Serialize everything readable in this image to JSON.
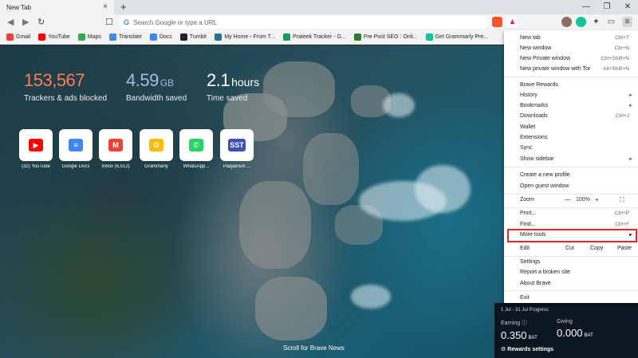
{
  "tabs": [
    {
      "label": "New Tab",
      "close": "×"
    }
  ],
  "newtab_symbol": "+",
  "window": {
    "minimize": "—",
    "maximize": "❐",
    "close": "✕"
  },
  "nav": {
    "back": "◀",
    "forward": "▶",
    "reload": "↻",
    "bookmark": "☐"
  },
  "omnibox": {
    "g": "G",
    "placeholder": "Search Google or type a URL"
  },
  "bookmarks": [
    {
      "label": "Gmail",
      "color": "#ea4335"
    },
    {
      "label": "YouTube",
      "color": "#ff0000"
    },
    {
      "label": "Maps",
      "color": "#34a853"
    },
    {
      "label": "Translate",
      "color": "#4285f4"
    },
    {
      "label": "Docs",
      "color": "#4285f4"
    },
    {
      "label": "Tumblr",
      "color": "#222"
    },
    {
      "label": "My Home ‹ From T...",
      "color": "#21759b"
    },
    {
      "label": "Prateek Tracker - G...",
      "color": "#0f9d58"
    },
    {
      "label": "Pre Post SEO : Onli...",
      "color": "#2e7d32"
    },
    {
      "label": "Get Grammarly Pre...",
      "color": "#15c39a"
    }
  ],
  "stats": [
    {
      "num": "153,567",
      "unit": "",
      "label": "Trackers & ads blocked",
      "color": "#ff7b54"
    },
    {
      "num": "4.59",
      "unit": "GB",
      "label": "Bandwidth saved",
      "color": "#a9b8dc"
    },
    {
      "num": "2.1",
      "unit": "hours",
      "label": "Time saved",
      "color": "#ffffff"
    }
  ],
  "sites": [
    {
      "name": "(32) YouTube",
      "glyph": "▶",
      "bg": "#ff0000"
    },
    {
      "name": "Google Docs",
      "glyph": "≡",
      "bg": "#4285f4"
    },
    {
      "name": "Inbox (6,512)",
      "glyph": "M",
      "bg": "#ea4335"
    },
    {
      "name": "Grammarly",
      "glyph": "G",
      "bg": "#fbbc05"
    },
    {
      "name": "WhatsApp...",
      "glyph": "✆",
      "bg": "#25d366"
    },
    {
      "name": "Plagiarism ...",
      "glyph": "SST",
      "bg": "#3f51b5"
    }
  ],
  "scroll_news": "Scroll for Brave News",
  "rewards": {
    "period": "1 Jul - 31 Jul Progress",
    "earning_label": "Earning ⓘ",
    "earning_value": "0.350",
    "giving_label": "Giving",
    "giving_value": "0.000",
    "currency": "BAT",
    "settings": "⚙ Rewards settings"
  },
  "menu": {
    "new_tab": {
      "label": "New tab",
      "shortcut": "Ctrl+T"
    },
    "new_window": {
      "label": "New window",
      "shortcut": "Ctrl+N"
    },
    "new_private": {
      "label": "New Private window",
      "shortcut": "Ctrl+Shift+N"
    },
    "new_private_tor": {
      "label": "New private window with Tor",
      "shortcut": "Alt+Shift+N"
    },
    "brave_rewards": "Brave Rewards",
    "history": "History",
    "bookmarks": "Bookmarks",
    "downloads": {
      "label": "Downloads",
      "shortcut": "Ctrl+J"
    },
    "wallet": "Wallet",
    "extensions": "Extensions",
    "sync": "Sync",
    "show_sidebar": "Show sidebar",
    "create_profile": "Create a new profile",
    "guest": "Open guest window",
    "zoom": {
      "label": "Zoom",
      "minus": "—",
      "value": "100%",
      "plus": "+",
      "fullscreen": "⛶"
    },
    "print": {
      "label": "Print...",
      "shortcut": "Ctrl+P"
    },
    "find": {
      "label": "Find...",
      "shortcut": "Ctrl+F"
    },
    "more_tools": "More tools",
    "edit": {
      "label": "Edit",
      "cut": "Cut",
      "copy": "Copy",
      "paste": "Paste"
    },
    "settings": "Settings",
    "report": "Report a broken site",
    "about": "About Brave",
    "exit": "Exit",
    "arrow": "►"
  },
  "highlight_color": "#d32f2f"
}
